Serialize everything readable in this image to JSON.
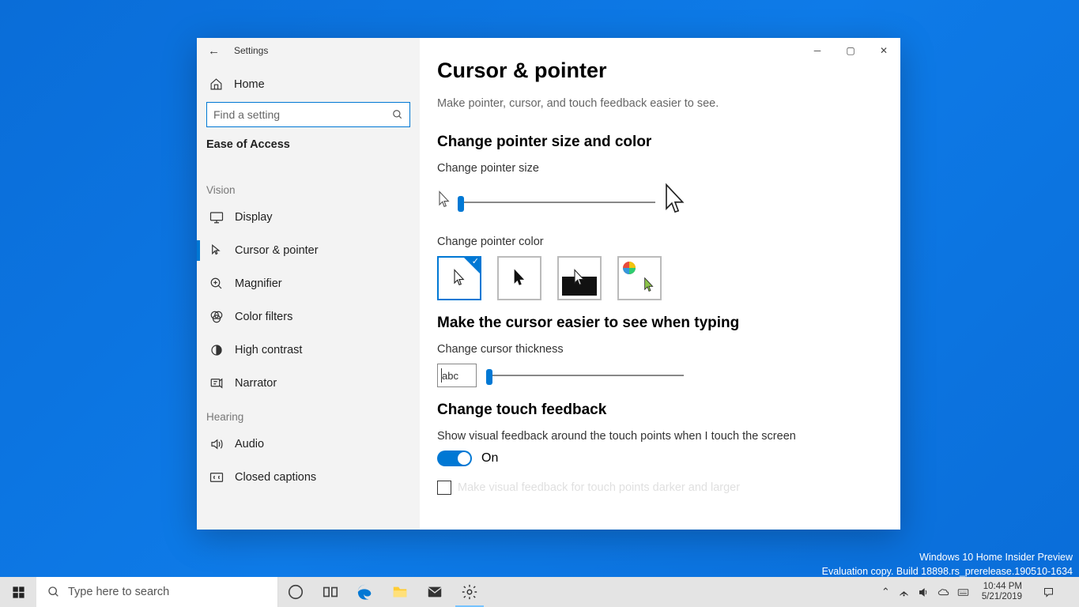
{
  "window": {
    "title": "Settings",
    "home": "Home",
    "search_placeholder": "Find a setting",
    "category": "Ease of Access"
  },
  "sidebar": {
    "groups": [
      {
        "label": "Vision",
        "items": [
          {
            "icon": "display",
            "label": "Display"
          },
          {
            "icon": "cursor",
            "label": "Cursor & pointer",
            "active": true
          },
          {
            "icon": "magnifier",
            "label": "Magnifier"
          },
          {
            "icon": "filters",
            "label": "Color filters"
          },
          {
            "icon": "contrast",
            "label": "High contrast"
          },
          {
            "icon": "narrator",
            "label": "Narrator"
          }
        ]
      },
      {
        "label": "Hearing",
        "items": [
          {
            "icon": "audio",
            "label": "Audio"
          },
          {
            "icon": "captions",
            "label": "Closed captions"
          }
        ]
      }
    ]
  },
  "main": {
    "title": "Cursor & pointer",
    "subtitle": "Make pointer, cursor, and touch feedback easier to see.",
    "section1_title": "Change pointer size and color",
    "size_label": "Change pointer size",
    "color_label": "Change pointer color",
    "section2_title": "Make the cursor easier to see when typing",
    "thickness_label": "Change cursor thickness",
    "abc_text": "abc",
    "section3_title": "Change touch feedback",
    "touch_desc": "Show visual feedback around the touch points when I touch the screen",
    "toggle_label": "On",
    "checkbox_label": "Make visual feedback for touch points darker and larger"
  },
  "watermark": {
    "line1": "Windows 10 Home Insider Preview",
    "line2": "Evaluation copy. Build 18898.rs_prerelease.190510-1634"
  },
  "taskbar": {
    "search_placeholder": "Type here to search",
    "time": "10:44 PM",
    "date": "5/21/2019"
  }
}
